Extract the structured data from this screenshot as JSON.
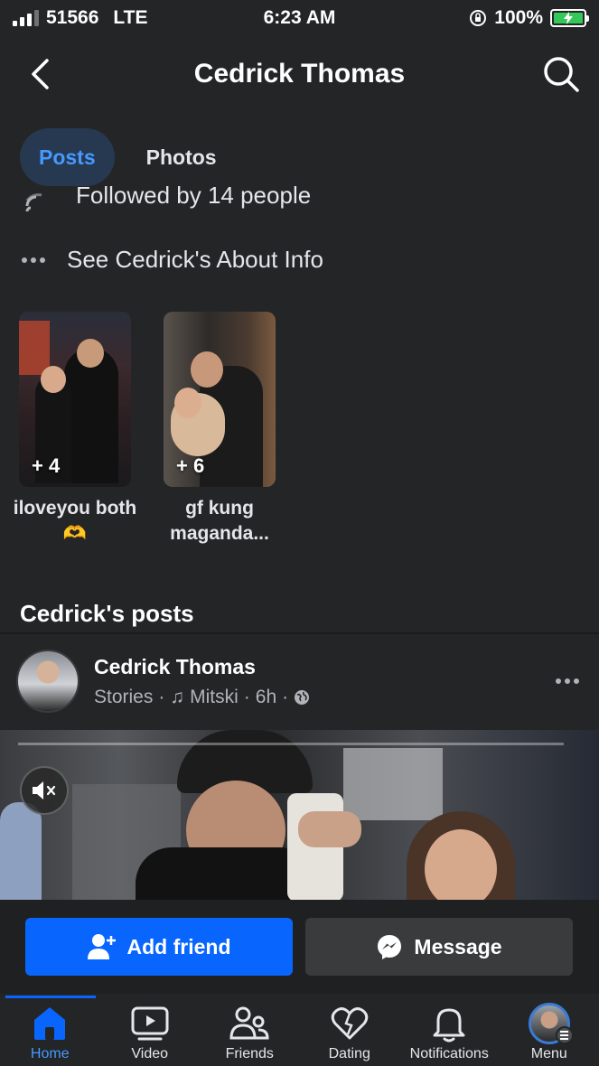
{
  "status_bar": {
    "carrier": "51566",
    "network": "LTE",
    "time": "6:23 AM",
    "battery": "100%"
  },
  "header": {
    "title": "Cedrick Thomas"
  },
  "tabs": [
    {
      "label": "Posts",
      "active": true
    },
    {
      "label": "Photos",
      "active": false
    }
  ],
  "intro": {
    "followed_by": "Followed by 14 people",
    "about_link": "See Cedrick's About Info"
  },
  "featured": [
    {
      "count": "+ 4",
      "caption": "iloveyou both 🫶"
    },
    {
      "count": "+ 6",
      "caption": "gf kung maganda..."
    }
  ],
  "posts_heading": "Cedrick's posts",
  "post": {
    "author": "Cedrick Thomas",
    "type": "Stories",
    "music": "Mitski",
    "time": "6h",
    "privacy_icon": "globe-icon"
  },
  "actions": {
    "add_friend": "Add friend",
    "message": "Message"
  },
  "tabbar": [
    {
      "label": "Home",
      "icon": "home-icon",
      "active": true
    },
    {
      "label": "Video",
      "icon": "video-icon",
      "active": false
    },
    {
      "label": "Friends",
      "icon": "friends-icon",
      "active": false
    },
    {
      "label": "Dating",
      "icon": "dating-icon",
      "active": false
    },
    {
      "label": "Notifications",
      "icon": "bell-icon",
      "active": false
    },
    {
      "label": "Menu",
      "icon": "menu-avatar",
      "active": false
    }
  ],
  "colors": {
    "background": "#242526",
    "accent": "#0866ff",
    "active_tab_bg": "#263951",
    "active_tab_text": "#4599ff",
    "battery": "#34c759"
  }
}
